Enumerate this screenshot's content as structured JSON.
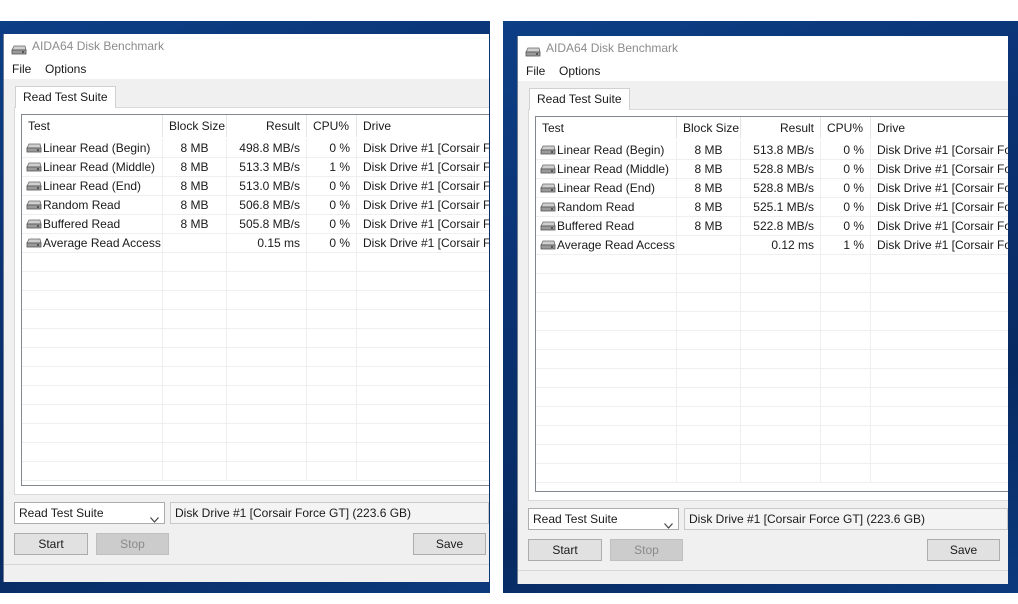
{
  "app_title": "AIDA64 Disk Benchmark",
  "menu": [
    "File",
    "Options"
  ],
  "tab_label": "Read Test Suite",
  "columns": [
    "Test",
    "Block Size",
    "Result",
    "CPU%",
    "Drive"
  ],
  "mode_select": "Read Test Suite",
  "drive_select": "Disk Drive #1  [Corsair Force GT]  (223.6 GB)",
  "buttons": {
    "start": "Start",
    "stop": "Stop",
    "save": "Save"
  },
  "windows": [
    {
      "rows": [
        {
          "test": "Linear Read (Begin)",
          "block": "8 MB",
          "result": "498.8 MB/s",
          "cpu": "0 %",
          "drive": "Disk Drive #1  [Corsair F"
        },
        {
          "test": "Linear Read (Middle)",
          "block": "8 MB",
          "result": "513.3 MB/s",
          "cpu": "1 %",
          "drive": "Disk Drive #1  [Corsair F"
        },
        {
          "test": "Linear Read (End)",
          "block": "8 MB",
          "result": "513.0 MB/s",
          "cpu": "0 %",
          "drive": "Disk Drive #1  [Corsair F"
        },
        {
          "test": "Random Read",
          "block": "8 MB",
          "result": "506.8 MB/s",
          "cpu": "0 %",
          "drive": "Disk Drive #1  [Corsair F"
        },
        {
          "test": "Buffered Read",
          "block": "8 MB",
          "result": "505.8 MB/s",
          "cpu": "0 %",
          "drive": "Disk Drive #1  [Corsair F"
        },
        {
          "test": "Average Read Access",
          "block": "",
          "result": "0.15 ms",
          "cpu": "0 %",
          "drive": "Disk Drive #1  [Corsair F"
        }
      ]
    },
    {
      "rows": [
        {
          "test": "Linear Read (Begin)",
          "block": "8 MB",
          "result": "513.8 MB/s",
          "cpu": "0 %",
          "drive": "Disk Drive #1  [Corsair Fo"
        },
        {
          "test": "Linear Read (Middle)",
          "block": "8 MB",
          "result": "528.8 MB/s",
          "cpu": "0 %",
          "drive": "Disk Drive #1  [Corsair Fo"
        },
        {
          "test": "Linear Read (End)",
          "block": "8 MB",
          "result": "528.8 MB/s",
          "cpu": "0 %",
          "drive": "Disk Drive #1  [Corsair Fo"
        },
        {
          "test": "Random Read",
          "block": "8 MB",
          "result": "525.1 MB/s",
          "cpu": "0 %",
          "drive": "Disk Drive #1  [Corsair Fo"
        },
        {
          "test": "Buffered Read",
          "block": "8 MB",
          "result": "522.8 MB/s",
          "cpu": "0 %",
          "drive": "Disk Drive #1  [Corsair Fo"
        },
        {
          "test": "Average Read Access",
          "block": "",
          "result": "0.12 ms",
          "cpu": "1 %",
          "drive": "Disk Drive #1  [Corsair Fo"
        }
      ]
    }
  ],
  "icons": {
    "app": "hard-disk-icon",
    "row": "hard-disk-icon",
    "dropdown": "chevron-down-icon"
  }
}
